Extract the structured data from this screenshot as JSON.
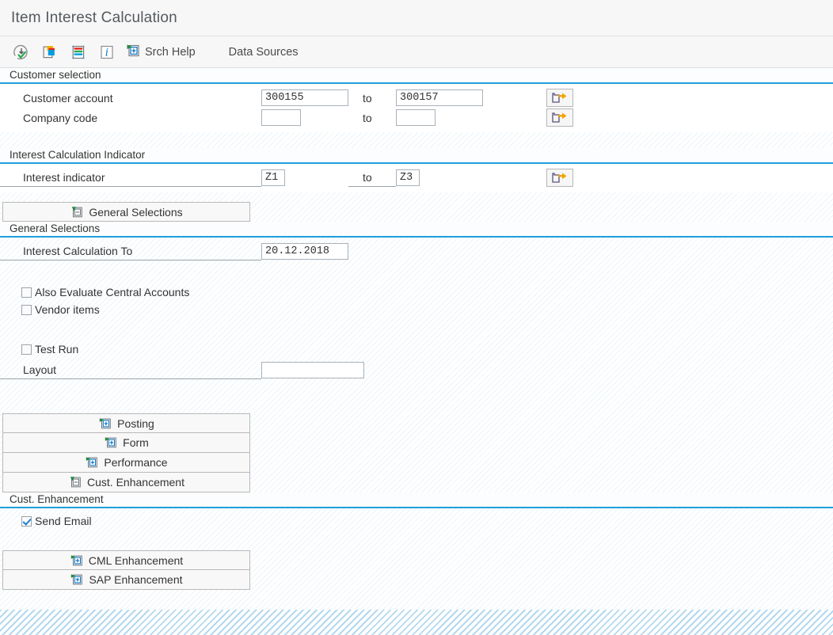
{
  "window": {
    "title": "Item Interest Calculation"
  },
  "toolbar": {
    "icons": [
      {
        "name": "execute-icon",
        "title": "Execute"
      },
      {
        "name": "variant-icon",
        "title": "Get Variant"
      },
      {
        "name": "list-icon",
        "title": "Display"
      },
      {
        "name": "info-icon",
        "title": "Information"
      }
    ],
    "srch_help_label": "Srch Help",
    "data_sources_label": "Data Sources"
  },
  "customer_selection": {
    "header": "Customer selection",
    "rows": [
      {
        "label": "Customer account",
        "from_value": "300155",
        "to_label": "to",
        "to_value": "300157",
        "multi_button": "multiple-selection-button"
      },
      {
        "label": "Company code",
        "from_value": "",
        "to_label": "to",
        "to_value": "",
        "multi_button": "multiple-selection-button"
      }
    ]
  },
  "interest_indicator_section": {
    "header": "Interest Calculation Indicator",
    "rows": [
      {
        "label": "Interest indicator",
        "from_value": "Z1",
        "to_label": "to",
        "to_value": "Z3",
        "multi_button": "multiple-selection-button"
      }
    ]
  },
  "general_selections": {
    "button_label": "General Selections",
    "header": "General Selections",
    "date_row": {
      "label": "Interest Calculation To",
      "value": "20.12.2018"
    },
    "checkboxes": [
      {
        "label": "Also Evaluate Central Accounts",
        "checked": false
      },
      {
        "label": "Vendor items",
        "checked": false
      },
      {
        "label": "Test Run",
        "checked": false
      }
    ],
    "layout_row": {
      "label": "Layout",
      "value": ""
    }
  },
  "section_buttons": [
    {
      "label": "Posting",
      "expanded": false
    },
    {
      "label": "Form",
      "expanded": false
    },
    {
      "label": "Performance",
      "expanded": false
    },
    {
      "label": "Cust. Enhancement",
      "expanded": true
    }
  ],
  "cust_enhancement": {
    "header": "Cust. Enhancement",
    "checkbox": {
      "label": "Send Email",
      "checked": true
    }
  },
  "bottom_buttons": [
    {
      "label": "CML Enhancement",
      "expanded": false
    },
    {
      "label": "SAP Enhancement",
      "expanded": false
    }
  ],
  "colors": {
    "accent_blue": "#1f9fdc",
    "titlebar_bg": "#f7f7f7",
    "text": "#333333",
    "check_blue": "#1f7fd0",
    "arrow_orange": "#f5a300",
    "expand_green": "#1f8a3c"
  }
}
